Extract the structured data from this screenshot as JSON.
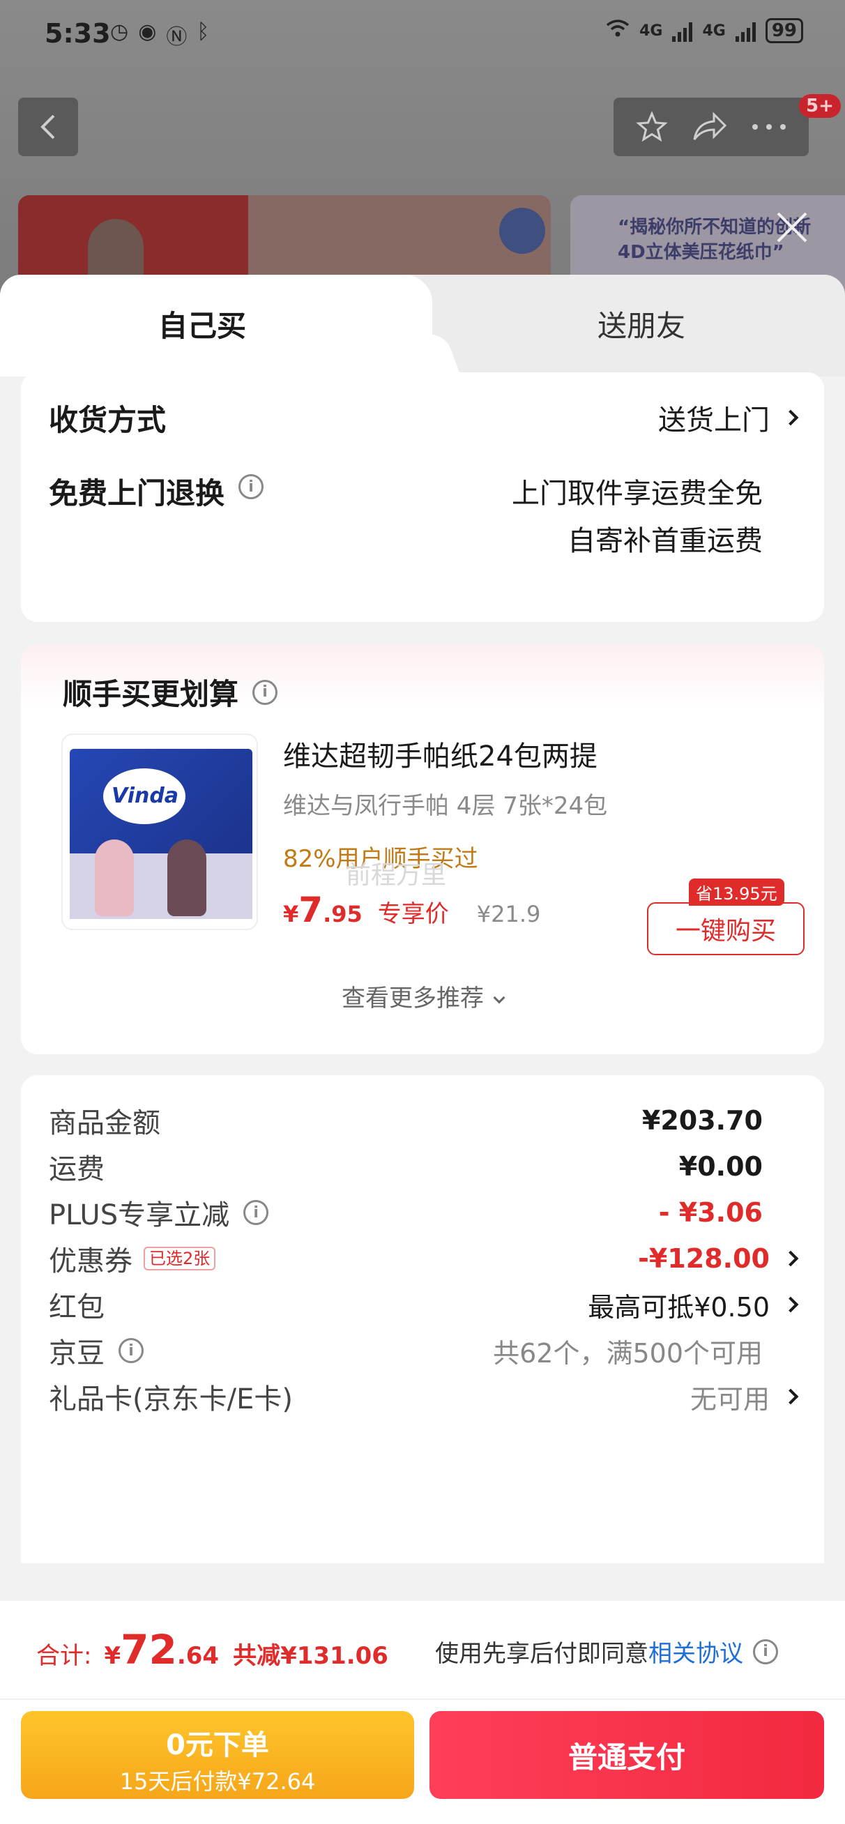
{
  "status_bar": {
    "time": "5:33",
    "network": "4G",
    "battery": "99"
  },
  "header": {
    "cart_badge": "5+"
  },
  "bg_banner_text": "“揭秘你所不知道的创新4D立体美压花纸巾”",
  "tabs": {
    "self": "自己买",
    "friend": "送朋友"
  },
  "delivery": {
    "method_label": "收货方式",
    "method_value": "送货上门",
    "return_label": "免费上门退换",
    "return_line1": "上门取件享运费全免",
    "return_line2": "自寄补首重运费"
  },
  "upsell": {
    "title": "顺手买更划算",
    "product_name": "维达超韧手帕纸24包两提",
    "product_spec": "维达与凤行手帕 4层 7张*24包",
    "product_rate": "82%用户顺手买过",
    "watermark": "前程万里",
    "price_yen": "¥",
    "price_int": "7",
    "price_dec": ".95",
    "price_tag": "专享价",
    "price_orig": "¥21.9",
    "save_badge": "省13.95元",
    "buy_label": "一键购买",
    "more_label": "查看更多推荐"
  },
  "fees": {
    "goods_label": "商品金额",
    "goods_value": "¥203.70",
    "shipping_label": "运费",
    "shipping_value": "¥0.00",
    "plus_label": "PLUS专享立减",
    "plus_value": "- ¥3.06",
    "coupon_label": "优惠券",
    "coupon_tag": "已选2张",
    "coupon_value": "-¥128.00",
    "redpacket_label": "红包",
    "redpacket_value": "最高可抵¥0.50",
    "jingdou_label": "京豆",
    "jingdou_value": "共62个，满500个可用",
    "giftcard_label": "礼品卡(京东卡/E卡)",
    "giftcard_value": "无可用"
  },
  "footer": {
    "total_label": "合计:",
    "total_yen": "¥",
    "total_int": "72",
    "total_dec": ".64",
    "total_saved": "共减¥131.06",
    "agree_text": "使用先享后付即同意",
    "agree_link": "相关协议",
    "later_title": "0元下单",
    "later_sub": "15天后付款¥72.64",
    "pay_label": "普通支付"
  },
  "colors": {
    "accent_red": "#e02b2b",
    "pay_btn": "#f2293f",
    "later_btn": "#f6a61a",
    "link": "#1f6fd6"
  }
}
